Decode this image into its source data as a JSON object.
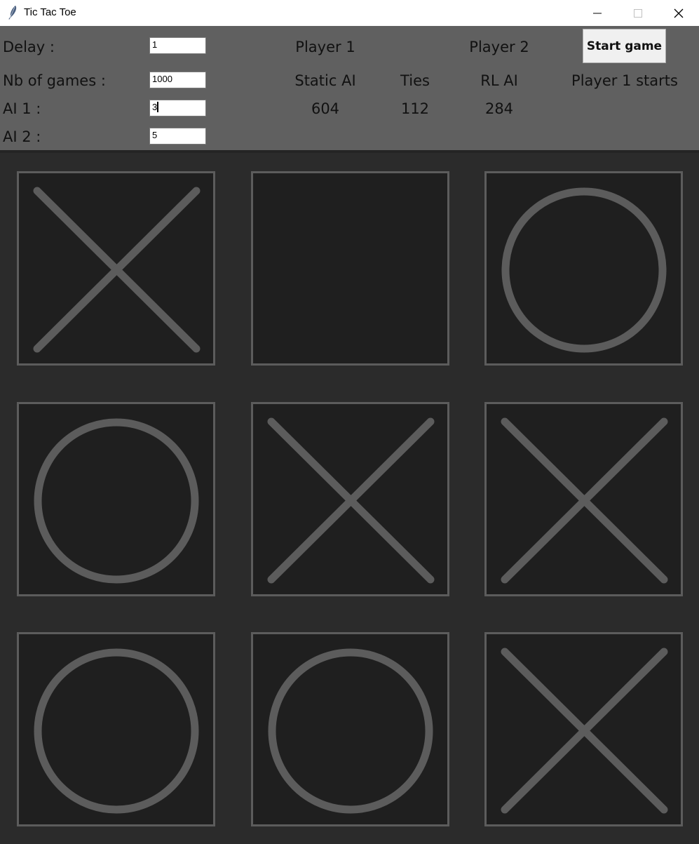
{
  "window": {
    "title": "Tic Tac Toe"
  },
  "settings": {
    "delay": {
      "label": "Delay :",
      "value": "1"
    },
    "nb_games": {
      "label": "Nb of games :",
      "value": "1000"
    },
    "ai1": {
      "label": "AI 1 :",
      "value": "3"
    },
    "ai2": {
      "label": "AI 2 :",
      "value": "5"
    }
  },
  "scoreboard": {
    "player1": {
      "heading": "Player 1",
      "name": "Static AI",
      "score": "604"
    },
    "ties": {
      "heading": "Ties",
      "score": "112"
    },
    "player2": {
      "heading": "Player 2",
      "name": "RL AI",
      "score": "284"
    }
  },
  "start_button": {
    "label": "Start game"
  },
  "status": "Player 1 starts",
  "board": [
    "X",
    "",
    "O",
    "O",
    "X",
    "X",
    "O",
    "O",
    "X"
  ],
  "colors": {
    "mark": "#5c5c5c",
    "cell_bg": "#1f1f1f",
    "header_bg": "#606060",
    "board_bg": "#2b2b2b"
  }
}
